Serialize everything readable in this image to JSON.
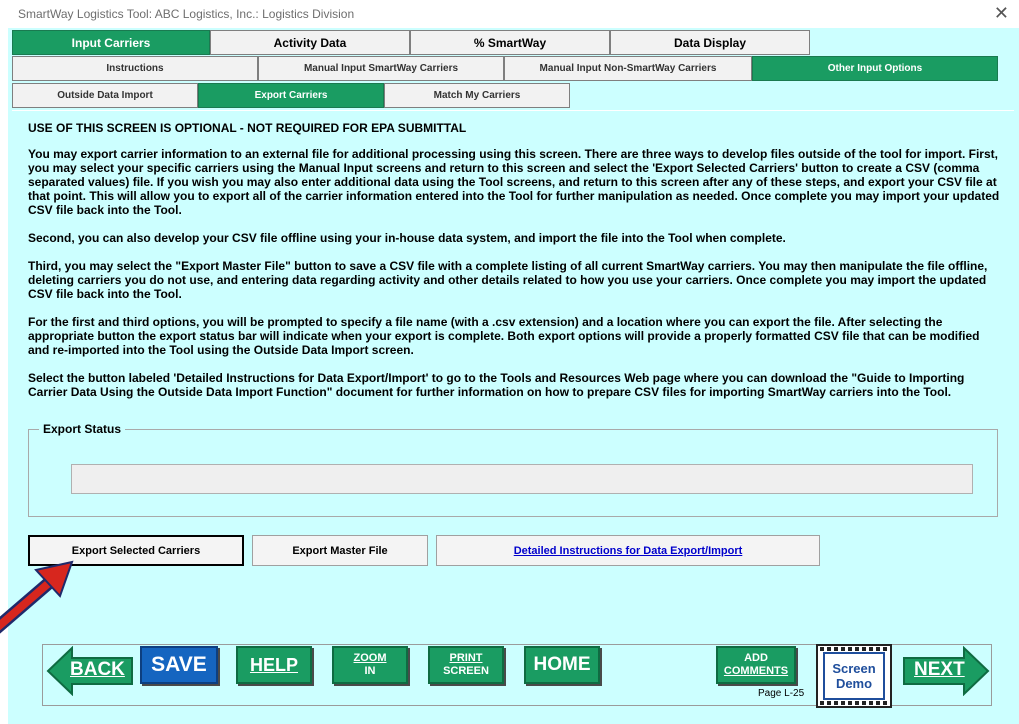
{
  "window": {
    "title": "SmartWay Logistics Tool: ABC Logistics, Inc.: Logistics Division",
    "close_glyph": "✕"
  },
  "tabs_row1": [
    {
      "label": "Input Carriers",
      "active": true
    },
    {
      "label": "Activity Data",
      "active": false
    },
    {
      "label": "% SmartWay",
      "active": false
    },
    {
      "label": "Data Display",
      "active": false
    }
  ],
  "tabs_row2": [
    {
      "label": "Instructions",
      "active": false
    },
    {
      "label": "Manual Input SmartWay Carriers",
      "active": false
    },
    {
      "label": "Manual Input Non-SmartWay Carriers",
      "active": false
    },
    {
      "label": "Other Input Options",
      "active": true
    }
  ],
  "tabs_row3": [
    {
      "label": "Outside Data Import",
      "active": false
    },
    {
      "label": "Export Carriers",
      "active": true
    },
    {
      "label": "Match My Carriers",
      "active": false
    }
  ],
  "content": {
    "heading": "USE OF THIS SCREEN IS OPTIONAL - NOT REQUIRED FOR EPA SUBMITTAL",
    "paragraphs": [
      "You may export carrier information to an external file for additional processing using this screen. There are three ways to develop files outside of the tool for import. First, you may select your specific carriers using the Manual Input screens and return to this screen and select the 'Export Selected Carriers' button to create a CSV (comma separated values) file.  If you wish you may also enter additional data using the Tool screens, and return to this screen after any of these steps, and export your CSV file at that point.  This will allow you to export all of the carrier information entered into the Tool for further manipulation as needed.  Once complete you may import your updated CSV file back into the Tool.",
      "Second, you can also develop your CSV file offline using your in-house data system, and import the file into the Tool when complete.",
      "Third, you may select the \"Export Master File\" button to save a CSV file with a complete listing of all current SmartWay carriers.  You may then manipulate the file offline, deleting carriers you do not use, and entering data regarding activity and other details related to how you use your carriers.  Once complete you may import the updated CSV file back into the Tool.",
      "For the first and third options, you will be prompted to specify a file name (with a .csv extension) and a location where you can export the file.  After selecting the appropriate button the export status bar will indicate when your export is complete.  Both export options will provide a properly formatted CSV file that can be modified and re-imported into the Tool using the Outside Data Import screen.",
      "Select the button labeled 'Detailed Instructions for Data Export/Import' to go to the Tools and Resources Web page where you can download the \"Guide to Importing Carrier Data Using the Outside Data Import Function\" document for further information on how to prepare CSV files for importing SmartWay carriers into the Tool."
    ],
    "export_status_label": "Export Status",
    "export_progress": 0
  },
  "buttons": {
    "export_selected": "Export Selected Carriers",
    "export_master": "Export Master File",
    "detailed_instructions": "Detailed Instructions for Data Export/Import"
  },
  "nav": {
    "back": "BACK",
    "save": "SAVE",
    "help": "HELP",
    "zoom_line1": "ZOOM",
    "zoom_line2": "IN",
    "print_line1": "PRINT",
    "print_line2": "SCREEN",
    "home": "HOME",
    "add_line1": "ADD",
    "add_line2": "COMMENTS",
    "page": "Page L-25",
    "demo_line1": "Screen",
    "demo_line2": "Demo",
    "next": "NEXT"
  },
  "colors": {
    "accent_green": "#1a9c62",
    "background": "#ccffff",
    "save_blue": "#1565c0",
    "arrow_red": "#d7261e"
  }
}
